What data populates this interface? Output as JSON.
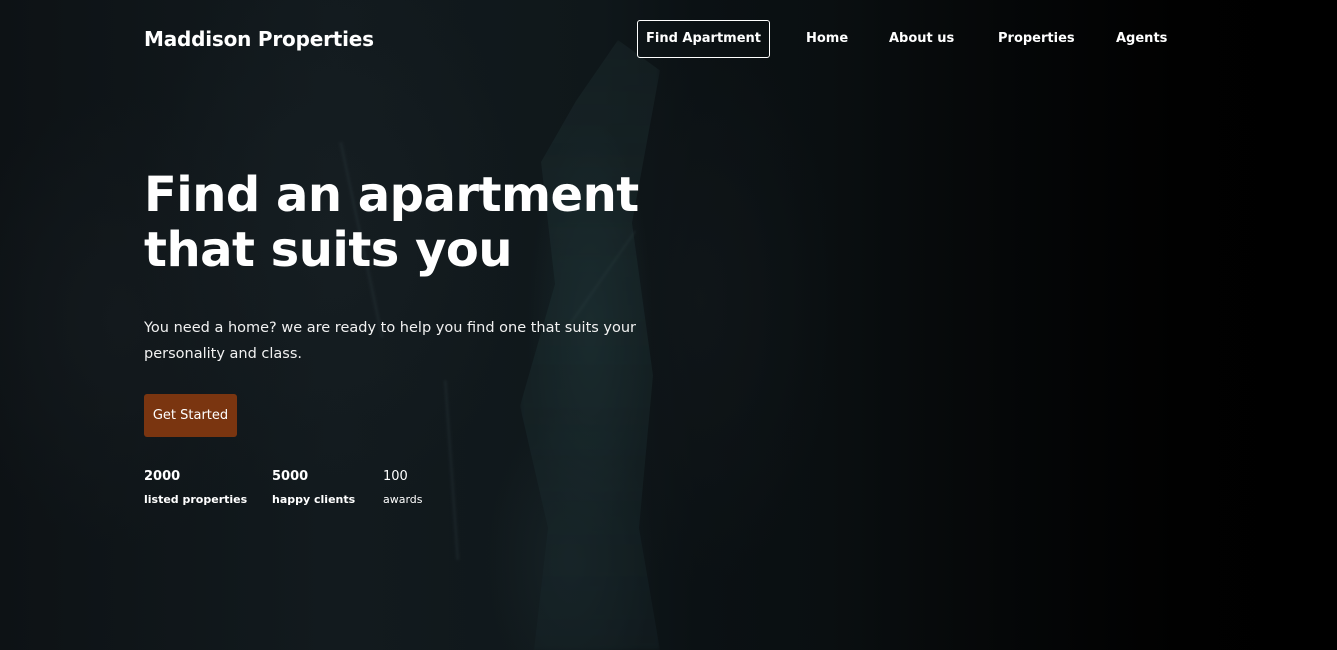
{
  "brand": {
    "name": "Maddison Properties"
  },
  "nav": {
    "cta_label": "Find Apartment",
    "links": [
      "Home",
      "About us",
      "Properties",
      "Agents"
    ]
  },
  "hero": {
    "title_line1": "Find an apartment",
    "title_line2": "that suits you",
    "subtitle": "You need a home? we are ready to help you find one that suits your personality and class.",
    "button_label": "Get Started"
  },
  "stats": [
    {
      "value": "2000",
      "label": "listed properties"
    },
    {
      "value": "5000",
      "label": "happy clients"
    },
    {
      "value": "100",
      "label": "awards"
    }
  ],
  "colors": {
    "accent": "#7a3510",
    "background": "#000000",
    "text": "#ffffff"
  }
}
